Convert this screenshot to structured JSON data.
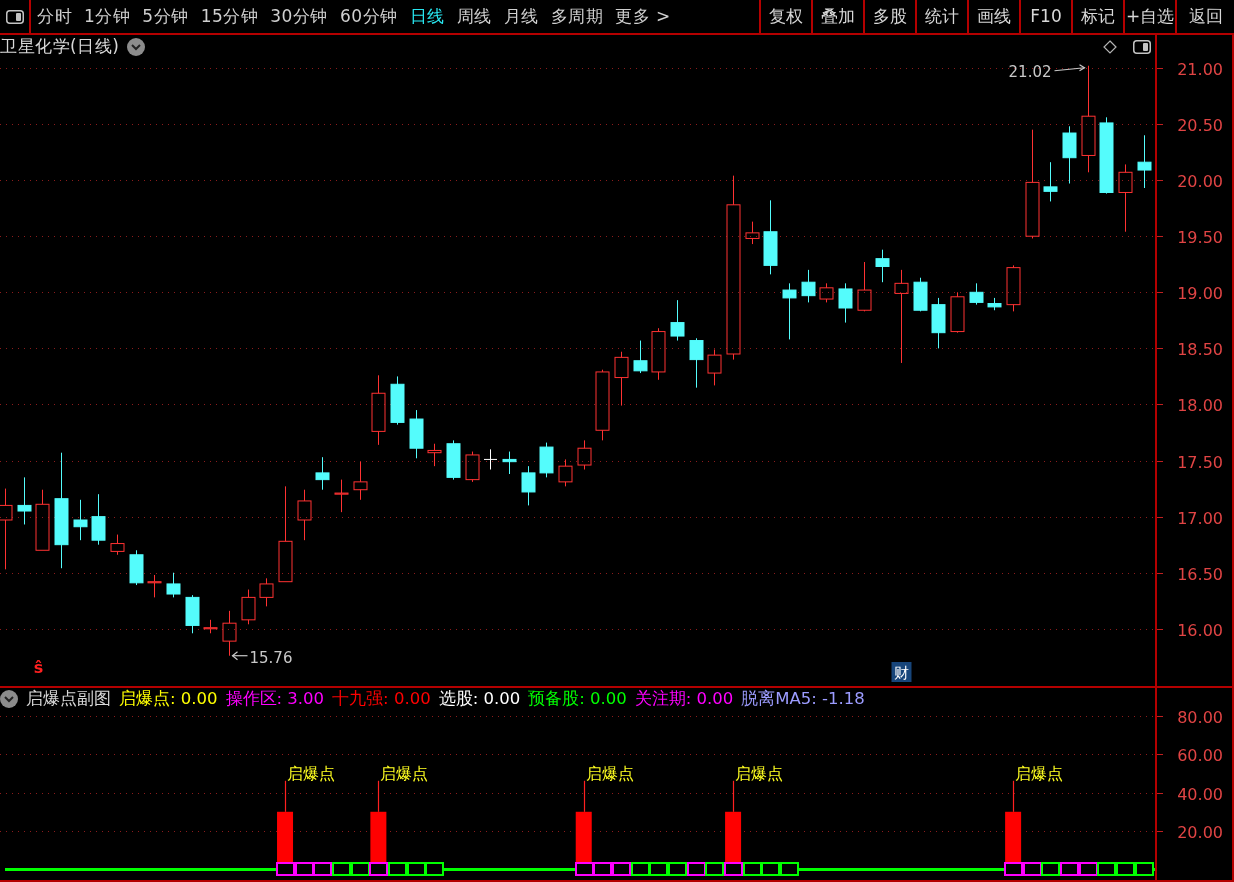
{
  "toolbar": {
    "tabs": [
      {
        "label": "分时",
        "selected": false
      },
      {
        "label": "1分钟",
        "selected": false
      },
      {
        "label": "5分钟",
        "selected": false
      },
      {
        "label": "15分钟",
        "selected": false
      },
      {
        "label": "30分钟",
        "selected": false
      },
      {
        "label": "60分钟",
        "selected": false
      },
      {
        "label": "日线",
        "selected": true
      },
      {
        "label": "周线",
        "selected": false
      },
      {
        "label": "月线",
        "selected": false
      },
      {
        "label": "多周期",
        "selected": false
      }
    ],
    "more": "更多 >",
    "buttons": [
      "复权",
      "叠加",
      "多股",
      "统计",
      "画线",
      "F10",
      "标记",
      "+自选",
      "返回"
    ]
  },
  "main_chart": {
    "title": "卫星化学(日线)",
    "price_axis": [
      "21.00",
      "20.50",
      "20.00",
      "19.50",
      "19.00",
      "18.50",
      "18.00",
      "17.50",
      "17.00",
      "16.50",
      "16.00"
    ],
    "high_label": "21.02",
    "low_label": "15.76",
    "event_row": [
      {
        "kind": "none"
      },
      {
        "kind": "none"
      },
      {
        "kind": "text",
        "text": "ŝ"
      },
      {
        "kind": "none"
      },
      {
        "kind": "none"
      },
      {
        "kind": "none"
      },
      {
        "kind": "none"
      },
      {
        "kind": "none"
      },
      {
        "kind": "none"
      },
      {
        "kind": "none"
      },
      {
        "kind": "none"
      },
      {
        "kind": "none"
      },
      {
        "kind": "none"
      },
      {
        "kind": "none"
      },
      {
        "kind": "none"
      },
      {
        "kind": "none"
      },
      {
        "kind": "none"
      },
      {
        "kind": "none"
      },
      {
        "kind": "none"
      },
      {
        "kind": "none"
      },
      {
        "kind": "none"
      },
      {
        "kind": "none"
      },
      {
        "kind": "none"
      },
      {
        "kind": "none"
      },
      {
        "kind": "none"
      },
      {
        "kind": "none"
      },
      {
        "kind": "none"
      },
      {
        "kind": "none"
      },
      {
        "kind": "none"
      },
      {
        "kind": "none"
      },
      {
        "kind": "none"
      },
      {
        "kind": "none"
      },
      {
        "kind": "none"
      },
      {
        "kind": "none"
      },
      {
        "kind": "none"
      },
      {
        "kind": "none"
      },
      {
        "kind": "none"
      },
      {
        "kind": "none"
      },
      {
        "kind": "none"
      },
      {
        "kind": "none"
      },
      {
        "kind": "none"
      },
      {
        "kind": "none"
      },
      {
        "kind": "none"
      },
      {
        "kind": "none"
      },
      {
        "kind": "none"
      },
      {
        "kind": "none"
      },
      {
        "kind": "none"
      },
      {
        "kind": "none"
      },
      {
        "kind": "badge",
        "text": "财"
      },
      {
        "kind": "none"
      },
      {
        "kind": "none"
      },
      {
        "kind": "none"
      },
      {
        "kind": "none"
      },
      {
        "kind": "none"
      },
      {
        "kind": "none"
      },
      {
        "kind": "none"
      },
      {
        "kind": "none"
      },
      {
        "kind": "none"
      },
      {
        "kind": "none"
      },
      {
        "kind": "none"
      },
      {
        "kind": "none"
      },
      {
        "kind": "none"
      }
    ]
  },
  "indicator_panel": {
    "title": "启爆点副图",
    "legend": [
      {
        "text": "启爆点: 0.00",
        "color": "#ffff00"
      },
      {
        "text": "操作区: 3.00",
        "color": "#ff00ff"
      },
      {
        "text": "十九强: 0.00",
        "color": "#ff0000"
      },
      {
        "text": "选股: 0.00",
        "color": "#ffffff"
      },
      {
        "text": "预备股: 0.00",
        "color": "#00ff00"
      },
      {
        "text": "关注期: 0.00",
        "color": "#ff00ff"
      },
      {
        "text": "脱离MA5: -1.18",
        "color": "#9c9cff"
      }
    ],
    "chart_data": {
      "type": "bar",
      "ylim": [
        3.8,
        83.1
      ],
      "yticks": [
        {
          "value": 80,
          "label": "80.00"
        },
        {
          "value": 60,
          "label": "60.00"
        },
        {
          "value": 40,
          "label": "40.00"
        },
        {
          "value": 20,
          "label": "20.00"
        }
      ],
      "grid": true,
      "series": [
        {
          "color": "#ff0000",
          "values": [
            null,
            null,
            null,
            null,
            null,
            null,
            null,
            null,
            null,
            null,
            null,
            null,
            null,
            null,
            null,
            30,
            null,
            null,
            null,
            null,
            30,
            null,
            null,
            null,
            null,
            null,
            null,
            null,
            null,
            null,
            null,
            30,
            null,
            null,
            null,
            null,
            null,
            null,
            null,
            30,
            null,
            null,
            null,
            null,
            null,
            null,
            null,
            null,
            null,
            null,
            null,
            null,
            null,
            null,
            30,
            null,
            null,
            null,
            null,
            null,
            null,
            null
          ]
        }
      ],
      "annotations": [
        "启爆点",
        "启爆点",
        "启爆点",
        "启爆点",
        "启爆点"
      ]
    },
    "zone_cells": [
      {
        "kind": "none"
      },
      {
        "kind": "none"
      },
      {
        "kind": "none"
      },
      {
        "kind": "none"
      },
      {
        "kind": "none"
      },
      {
        "kind": "none"
      },
      {
        "kind": "none"
      },
      {
        "kind": "none"
      },
      {
        "kind": "none"
      },
      {
        "kind": "none"
      },
      {
        "kind": "none"
      },
      {
        "kind": "none"
      },
      {
        "kind": "none"
      },
      {
        "kind": "none"
      },
      {
        "kind": "none"
      },
      {
        "kind": "box",
        "color": "#ff00ff"
      },
      {
        "kind": "box",
        "color": "#ff00ff"
      },
      {
        "kind": "box",
        "color": "#ff00ff"
      },
      {
        "kind": "box",
        "color": "#00ff00"
      },
      {
        "kind": "box",
        "color": "#00ff00"
      },
      {
        "kind": "box",
        "color": "#ff00ff"
      },
      {
        "kind": "box",
        "color": "#00ff00"
      },
      {
        "kind": "box",
        "color": "#00ff00"
      },
      {
        "kind": "box",
        "color": "#00ff00"
      },
      {
        "kind": "none"
      },
      {
        "kind": "none"
      },
      {
        "kind": "none"
      },
      {
        "kind": "none"
      },
      {
        "kind": "none"
      },
      {
        "kind": "none"
      },
      {
        "kind": "none"
      },
      {
        "kind": "box",
        "color": "#ff00ff"
      },
      {
        "kind": "box",
        "color": "#ff00ff"
      },
      {
        "kind": "box",
        "color": "#ff00ff"
      },
      {
        "kind": "box",
        "color": "#00ff00"
      },
      {
        "kind": "box",
        "color": "#00ff00"
      },
      {
        "kind": "box",
        "color": "#00ff00"
      },
      {
        "kind": "box",
        "color": "#ff00ff"
      },
      {
        "kind": "box",
        "color": "#00ff00"
      },
      {
        "kind": "box",
        "color": "#ff00ff"
      },
      {
        "kind": "box",
        "color": "#00ff00"
      },
      {
        "kind": "box",
        "color": "#00ff00"
      },
      {
        "kind": "box",
        "color": "#00ff00"
      },
      {
        "kind": "none"
      },
      {
        "kind": "none"
      },
      {
        "kind": "none"
      },
      {
        "kind": "none"
      },
      {
        "kind": "none"
      },
      {
        "kind": "none"
      },
      {
        "kind": "none"
      },
      {
        "kind": "none"
      },
      {
        "kind": "none"
      },
      {
        "kind": "none"
      },
      {
        "kind": "none"
      },
      {
        "kind": "box",
        "color": "#ff00ff"
      },
      {
        "kind": "box",
        "color": "#ff00ff"
      },
      {
        "kind": "box",
        "color": "#00ff00"
      },
      {
        "kind": "box",
        "color": "#ff00ff"
      },
      {
        "kind": "box",
        "color": "#ff00ff"
      },
      {
        "kind": "box",
        "color": "#00ff00"
      },
      {
        "kind": "box",
        "color": "#00ff00"
      },
      {
        "kind": "box",
        "color": "#00ff00"
      }
    ]
  }
}
